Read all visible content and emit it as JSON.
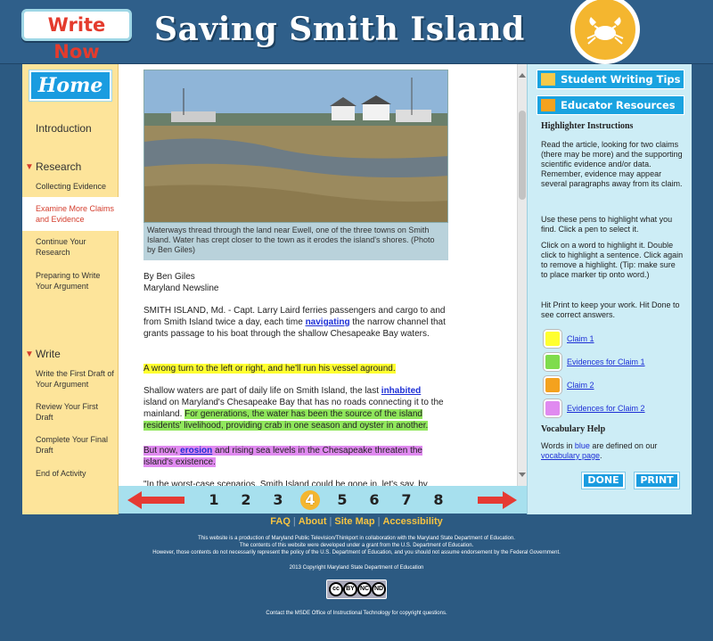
{
  "header": {
    "write_now": "Write Now",
    "title": "Saving Smith Island"
  },
  "leftnav": {
    "home": "Home",
    "introduction": "Introduction",
    "research_head": "Research",
    "research_items": [
      "Collecting Evidence",
      "Examine More Claims and Evidence",
      "Continue Your Research",
      "Preparing to Write Your Argument"
    ],
    "write_head": "Write",
    "write_items": [
      "Write the First Draft of Your Argument",
      "Review Your First Draft",
      "Complete Your Final Draft",
      "End of Activity"
    ]
  },
  "article": {
    "caption": "Waterways thread through the land near Ewell, one of the three towns on Smith Island. Water has crept closer to the town as it erodes the island's shores. (Photo by Ben Giles)",
    "byline1": "By Ben Giles",
    "byline2": "Maryland Newsline",
    "p1_a": "SMITH ISLAND, Md. - Capt. Larry Laird ferries passengers and cargo to and from Smith Island twice a day, each time ",
    "p1_link": "navigating",
    "p1_b": " the narrow channel that grants passage to his boat through the shallow Chesapeake Bay waters.",
    "p2": "A wrong turn to the left or right, and he'll run his vessel aground.",
    "p3_a": "Shallow waters are part of daily life on Smith Island, the last ",
    "p3_link": "inhabited",
    "p3_b": " island on Maryland's Chesapeake Bay that has no roads connecting it to the mainland. ",
    "p3_hl": "For generations, the water has been the source of the island residents' livelihood, providing crab in one season and oyster in another.",
    "p4_a": "But now, ",
    "p4_link": "erosion",
    "p4_b": " and rising sea levels in the Chesapeake threaten the island's existence.",
    "p5": "\"In the worst-case scenarios, Smith Island could be gone in, let's say, by"
  },
  "pagination": {
    "pages": [
      "1",
      "2",
      "3",
      "4",
      "5",
      "6",
      "7",
      "8"
    ],
    "active": "4"
  },
  "rightpanel": {
    "tips": "Student Writing Tips",
    "educator": "Educator Resources",
    "hl_head": "Highlighter Instructions",
    "hl_text1": "Read the article, looking for two claims (there may be more) and the supporting scientific evidence and/or data. Remember, evidence may appear several paragraphs away from its claim.",
    "hl_text2": "Use these pens to highlight what you find. Click a pen to select it.",
    "hl_text3": "Click on a word to highlight it. Double click to highlight a sentence. Click again to remove a highlight. (Tip: make sure to place marker tip onto word.)",
    "hl_text4": "Hit Print to keep your work. Hit Done to see correct answers.",
    "pens": [
      "Claim 1",
      "Evidences for Claim 1",
      "Claim 2",
      "Evidences for Claim 2"
    ],
    "pen_colors": [
      "#ffff30",
      "#7fdc4c",
      "#f4a21e",
      "#e08af0"
    ],
    "vocab_head": "Vocabulary Help",
    "vocab_a": "Words in ",
    "vocab_blue": "blue",
    "vocab_b": " are defined on our ",
    "vocab_link": "vocabulary page",
    "vocab_end": ".",
    "done": "DONE",
    "print": "PRINT"
  },
  "footer": {
    "links": [
      "FAQ",
      "About",
      "Site Map",
      "Accessibility"
    ],
    "line1": "This website is a production of Maryland Public Television/Thinkport in collaboration with the Maryland State Department of Education.",
    "line2": "The contents of this website were developed under a grant from the U.S. Department of Education.",
    "line3": "However, those contents do not necessarily represent the policy of the U.S. Department of Education, and you should not assume endorsement by the Federal Government.",
    "copyright": "2013 Copyright Maryland State Department of Education",
    "contact": "Contact the MSDE Office of Instructional Technology for copyright questions.",
    "cc_badges": [
      "cc",
      "BY",
      "NC",
      "ND"
    ]
  }
}
